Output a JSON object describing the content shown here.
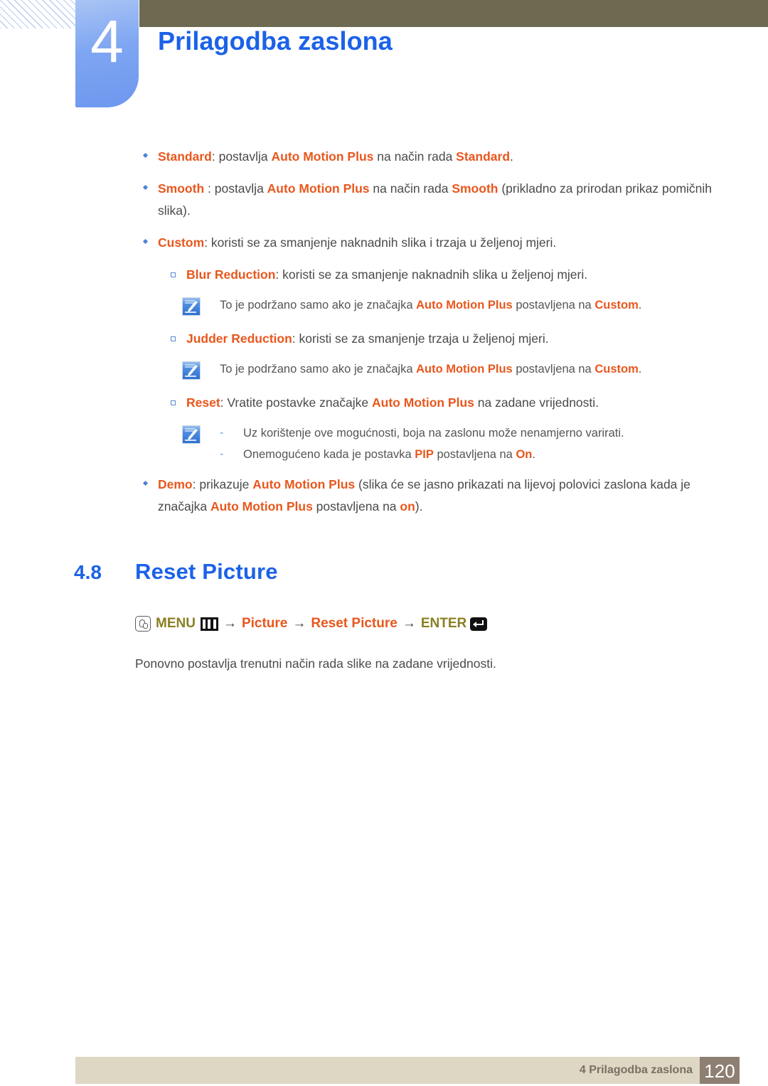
{
  "header": {
    "chapter_number": "4",
    "chapter_title": "Prilagodba zaslona",
    "accent_blue": "#1b62e8",
    "tab_blue": "#7fa6f2",
    "olive": "#6e6a52"
  },
  "bullets": [
    {
      "level": 1,
      "marker": "diamond",
      "parts": [
        {
          "text": "Standard",
          "style": "kw"
        },
        {
          "text": ": postavlja ",
          "style": "plain"
        },
        {
          "text": "Auto Motion Plus",
          "style": "kw"
        },
        {
          "text": " na način rada ",
          "style": "plain"
        },
        {
          "text": "Standard",
          "style": "kw"
        },
        {
          "text": ".",
          "style": "plain"
        }
      ]
    },
    {
      "level": 1,
      "marker": "diamond",
      "parts": [
        {
          "text": "Smooth",
          "style": "kw"
        },
        {
          "text": " : postavlja ",
          "style": "plain"
        },
        {
          "text": "Auto Motion Plus",
          "style": "kw"
        },
        {
          "text": " na način rada ",
          "style": "plain"
        },
        {
          "text": "Smooth",
          "style": "kw"
        },
        {
          "text": " (prikladno za prirodan prikaz pomičnih slika).",
          "style": "plain"
        }
      ]
    },
    {
      "level": 1,
      "marker": "diamond",
      "parts": [
        {
          "text": "Custom",
          "style": "kw"
        },
        {
          "text": ": koristi se za smanjenje naknadnih slika i trzaja u željenoj mjeri.",
          "style": "plain"
        }
      ]
    },
    {
      "level": 2,
      "marker": "square",
      "parts": [
        {
          "text": "Blur Reduction",
          "style": "kw"
        },
        {
          "text": ": koristi se za smanjenje naknadnih slika u željenoj mjeri.",
          "style": "plain"
        }
      ]
    },
    {
      "level": 2,
      "marker": "square",
      "parts": [
        {
          "text": "Judder Reduction",
          "style": "kw"
        },
        {
          "text": ": koristi se za smanjenje trzaja u željenoj mjeri.",
          "style": "plain"
        }
      ]
    },
    {
      "level": 2,
      "marker": "square",
      "parts": [
        {
          "text": "Reset",
          "style": "kw"
        },
        {
          "text": ": Vratite postavke značajke ",
          "style": "plain"
        },
        {
          "text": "Auto Motion Plus",
          "style": "kw"
        },
        {
          "text": " na zadane vrijednosti.",
          "style": "plain"
        }
      ]
    },
    {
      "level": 1,
      "marker": "diamond",
      "parts": [
        {
          "text": "Demo",
          "style": "kw"
        },
        {
          "text": ": prikazuje ",
          "style": "plain"
        },
        {
          "text": "Auto Motion Plus",
          "style": "kw"
        },
        {
          "text": " (slika će se jasno prikazati na lijevoj polovici zaslona kada je značajka ",
          "style": "plain"
        },
        {
          "text": "Auto Motion Plus",
          "style": "kw"
        },
        {
          "text": " postavljena na ",
          "style": "plain"
        },
        {
          "text": "on",
          "style": "kw"
        },
        {
          "text": ").",
          "style": "plain"
        }
      ]
    }
  ],
  "notes": {
    "note_blur": {
      "icon": "note-pen-icon",
      "lines": [
        {
          "dash": false,
          "parts": [
            {
              "text": "To je podržano samo ako je značajka ",
              "style": "plain"
            },
            {
              "text": "Auto Motion Plus",
              "style": "kw"
            },
            {
              "text": " postavljena na ",
              "style": "plain"
            },
            {
              "text": "Custom",
              "style": "kw"
            },
            {
              "text": ".",
              "style": "plain"
            }
          ]
        }
      ]
    },
    "note_judder": {
      "icon": "note-pen-icon",
      "lines": [
        {
          "dash": false,
          "parts": [
            {
              "text": "To je podržano samo ako je značajka ",
              "style": "plain"
            },
            {
              "text": "Auto Motion Plus",
              "style": "kw"
            },
            {
              "text": " postavljena na ",
              "style": "plain"
            },
            {
              "text": "Custom",
              "style": "kw"
            },
            {
              "text": ".",
              "style": "plain"
            }
          ]
        }
      ]
    },
    "note_reset": {
      "icon": "note-pen-icon",
      "lines": [
        {
          "dash": true,
          "parts": [
            {
              "text": "Uz korištenje ove mogućnosti, boja na zaslonu može nenamjerno varirati.",
              "style": "plain"
            }
          ]
        },
        {
          "dash": true,
          "parts": [
            {
              "text": "Onemogućeno kada je postavka ",
              "style": "plain"
            },
            {
              "text": "PIP",
              "style": "kw"
            },
            {
              "text": " postavljena na ",
              "style": "plain"
            },
            {
              "text": "On",
              "style": "kw"
            },
            {
              "text": ".",
              "style": "plain"
            }
          ]
        }
      ]
    }
  },
  "section": {
    "number": "4.8",
    "name": "Reset Picture"
  },
  "menu_path": {
    "hand_icon": "hand-press-icon",
    "menu_label": "MENU",
    "bars_icon": "menu-bars-icon",
    "arrow1": "→",
    "item1": "Picture",
    "arrow2": "→",
    "item2": "Reset Picture",
    "arrow3": "→",
    "enter_label": "ENTER",
    "enter_icon": "enter-key-icon",
    "olive_color": "#8a7f22",
    "orange_color": "#e8571d"
  },
  "body_paragraph": "Ponovno postavlja trenutni način rada slike na zadane vrijednosti.",
  "footer": {
    "label": "4 Prilagodba zaslona",
    "page_number": "120",
    "bar_color": "#ddd7c4",
    "page_box_color": "#8d7f72"
  }
}
